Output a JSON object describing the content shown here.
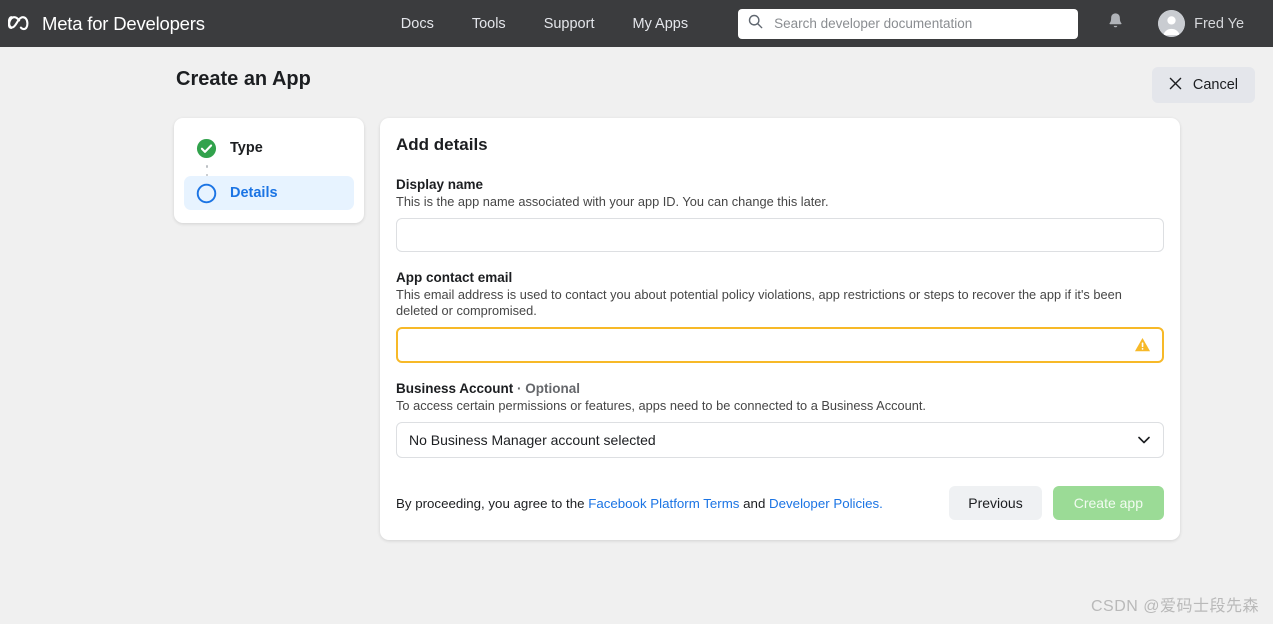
{
  "topnav": {
    "brand": "Meta for Developers",
    "brand_logo_icon": "meta-infinity-logo",
    "links": [
      {
        "label": "Docs"
      },
      {
        "label": "Tools"
      },
      {
        "label": "Support"
      },
      {
        "label": "My Apps"
      }
    ],
    "search": {
      "icon": "search-icon",
      "placeholder": "Search developer documentation",
      "value": ""
    },
    "notifications_icon": "bell-icon",
    "user": {
      "name": "Fred Ye",
      "avatar_icon": "user-avatar-icon"
    },
    "background_color": "#3b3c3e"
  },
  "page": {
    "title": "Create an App",
    "cancel_label": "Cancel",
    "cancel_icon": "close-icon",
    "background_color": "#f0f0f0"
  },
  "steps": [
    {
      "label": "Type",
      "state": "complete",
      "icon": "check-circle-icon"
    },
    {
      "label": "Details",
      "state": "active",
      "icon": "circle-outline-icon"
    }
  ],
  "form": {
    "title": "Add details",
    "display_name": {
      "label": "Display name",
      "description": "This is the app name associated with your app ID. You can change this later.",
      "value": "",
      "placeholder": ""
    },
    "contact_email": {
      "label": "App contact email",
      "description": "This email address is used to contact you about potential policy violations, app restrictions or steps to recover the app if it's been deleted or compromised.",
      "value": "",
      "placeholder": "",
      "state": "error-focused",
      "warning_icon": "warning-triangle-icon",
      "border_color": "#f7b928"
    },
    "business_account": {
      "label": "Business Account",
      "optional_label": "· Optional",
      "description": "To access certain permissions or features, apps need to be connected to a Business Account.",
      "selected_option": "No Business Manager account selected",
      "caret_icon": "chevron-down-icon"
    }
  },
  "footer": {
    "terms_prefix": "By proceeding, you agree to the ",
    "terms_link_1": "Facebook Platform Terms",
    "terms_middle": " and ",
    "terms_link_2": "Developer Policies.",
    "previous_label": "Previous",
    "create_label": "Create app",
    "create_button_color": "#9bdb96",
    "link_color": "#1b74e4"
  },
  "watermark": "CSDN @爱码士段先森"
}
